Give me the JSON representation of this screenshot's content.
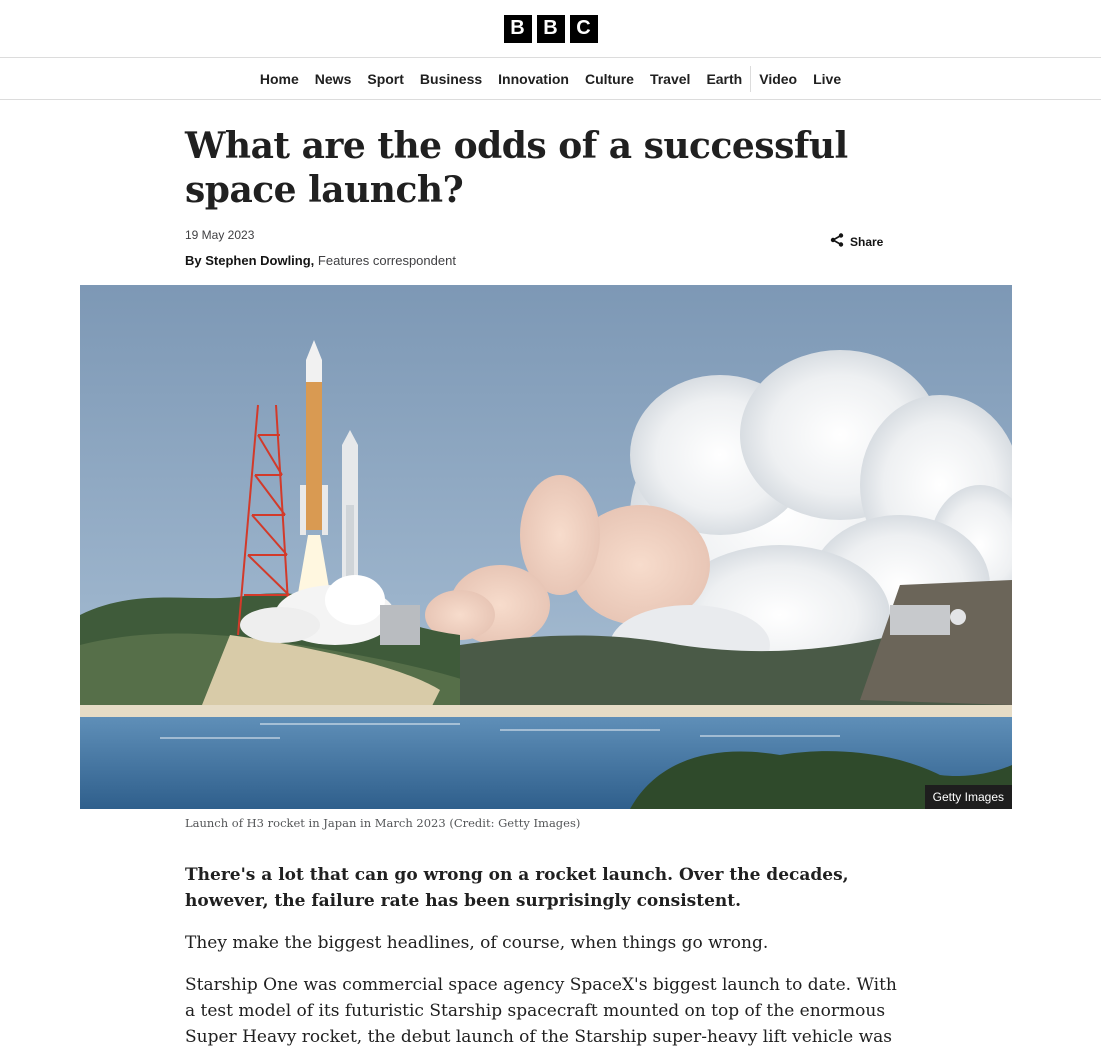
{
  "brand": {
    "logo_letters": [
      "B",
      "B",
      "C"
    ]
  },
  "nav": {
    "items": [
      "Home",
      "News",
      "Sport",
      "Business",
      "Innovation",
      "Culture",
      "Travel",
      "Earth",
      "Video",
      "Live"
    ]
  },
  "article": {
    "headline": "What are the odds of a successful space launch?",
    "date": "19 May 2023",
    "byline_prefix": "By Stephen Dowling,",
    "byline_role": "Features correspondent",
    "share_label": "Share",
    "image_credit_badge": "Getty Images",
    "image_caption": "Launch of H3 rocket in Japan in March 2023 (Credit: Getty Images)",
    "paragraphs": [
      "There's a lot that can go wrong on a rocket launch. Over the decades, however, the failure rate has been surprisingly consistent.",
      "They make the biggest headlines, of course, when things go wrong.",
      "Starship One was commercial space agency SpaceX's biggest launch to date. With a test model of its futuristic Starship spacecraft mounted on top of the enormous Super Heavy rocket, the debut launch of the Starship super-heavy lift vehicle was the subject"
    ]
  },
  "icons": {
    "share": "share-icon"
  }
}
